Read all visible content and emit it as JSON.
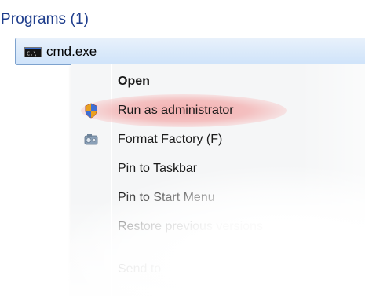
{
  "section": {
    "title": "Programs (1)"
  },
  "result": {
    "label": "cmd.exe",
    "icon": "cmd-console-icon"
  },
  "context_menu": {
    "items": [
      {
        "label": "Open",
        "default": true,
        "icon": ""
      },
      {
        "label": "Run as administrator",
        "default": false,
        "icon": "uac-shield-icon",
        "highlighted": true
      },
      {
        "label": "Format Factory (F)",
        "default": false,
        "icon": "format-factory-icon"
      },
      {
        "label": "Pin to Taskbar",
        "default": false,
        "icon": ""
      },
      {
        "label": "Pin to Start Menu",
        "default": false,
        "icon": ""
      },
      {
        "label": "Restore previous versions",
        "default": false,
        "icon": ""
      },
      {
        "label": "Send to",
        "default": false,
        "icon": ""
      }
    ]
  },
  "colors": {
    "section_title": "#1e3d8c",
    "selection_border": "#7da2ce",
    "highlight": "#f4abab"
  }
}
